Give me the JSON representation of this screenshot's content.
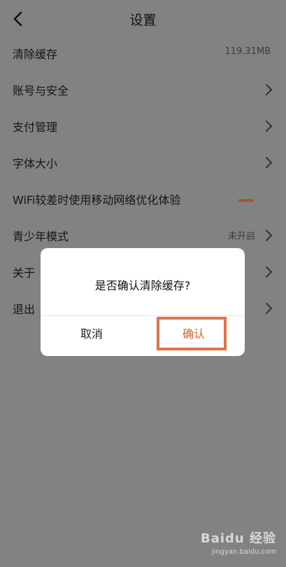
{
  "header": {
    "title": "设置"
  },
  "rows": [
    {
      "label": "清除缓存",
      "value": "119.31MB"
    },
    {
      "label": "账号与安全"
    },
    {
      "label": "支付管理"
    },
    {
      "label": "字体大小"
    },
    {
      "label": "WiFi较差时使用移动网络优化体验"
    },
    {
      "label": "青少年模式",
      "value": "未开启"
    },
    {
      "label": "关于"
    },
    {
      "label": "退出"
    }
  ],
  "dialog": {
    "message": "是否确认清除缓存?",
    "cancel_label": "取消",
    "confirm_label": "确认"
  },
  "watermark": {
    "brand": "Baidu 经验",
    "url": "jingyan.baidu.com"
  },
  "colors": {
    "accent": "#d7622f",
    "highlight": "#e07447",
    "overlay": "#828282"
  }
}
